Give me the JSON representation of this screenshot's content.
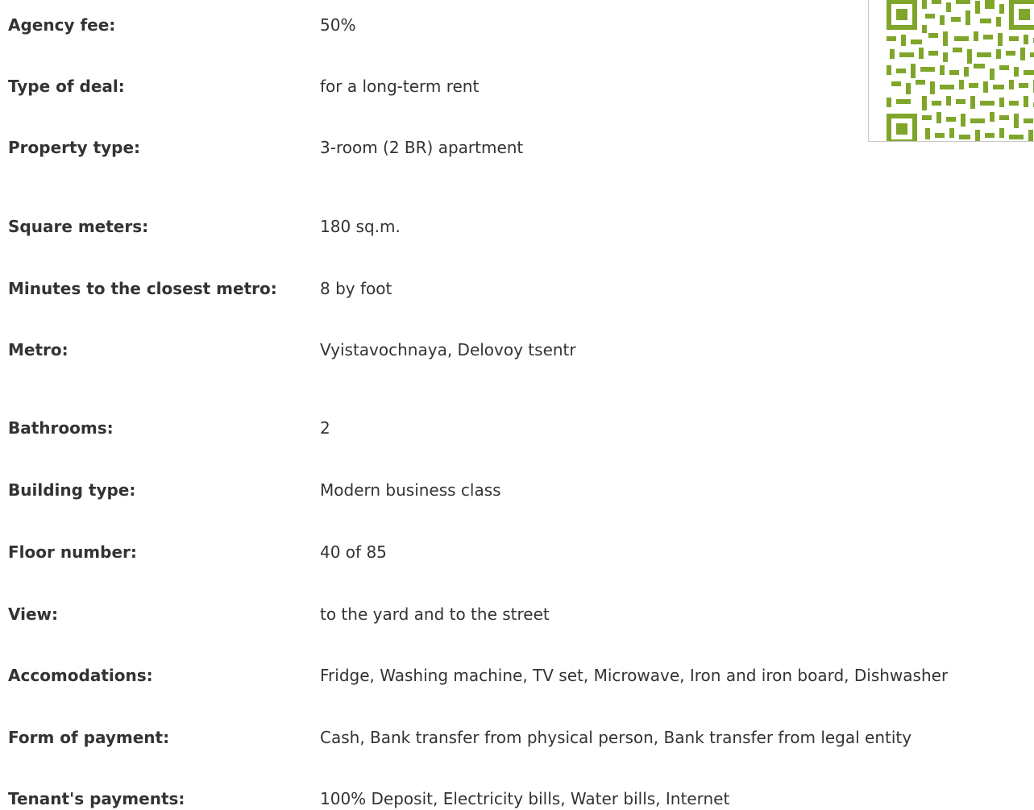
{
  "details": [
    {
      "label": "Agency fee:",
      "value": "50%"
    },
    {
      "label": "Type of deal:",
      "value": "for a long-term rent"
    },
    {
      "label": "Property type:",
      "value": "3-room (2 BR) apartment"
    },
    {
      "label": "Square meters:",
      "value": "180 sq.m."
    },
    {
      "label": "Minutes to the closest metro:",
      "value": "8 by foot"
    },
    {
      "label": "Metro:",
      "value": "Vyistavochnaya, Delovoy tsentr"
    },
    {
      "label": "Bathrooms:",
      "value": "2"
    },
    {
      "label": "Building type:",
      "value": "Modern business class"
    },
    {
      "label": "Floor number:",
      "value": "40 of 85"
    },
    {
      "label": "View:",
      "value": "to the yard and to the street"
    },
    {
      "label": "Accomodations:",
      "value": "Fridge, Washing machine, TV set, Microwave, Iron and iron board, Dishwasher"
    },
    {
      "label": "Form of payment:",
      "value": "Cash, Bank transfer from physical person, Bank transfer from legal entity"
    },
    {
      "label": "Tenant's payments:",
      "value": "100% Deposit, Electricity bills, Water bills, Internet"
    }
  ],
  "qr_code": {
    "icon": "qr-code-icon",
    "color": "#7fa62a"
  }
}
